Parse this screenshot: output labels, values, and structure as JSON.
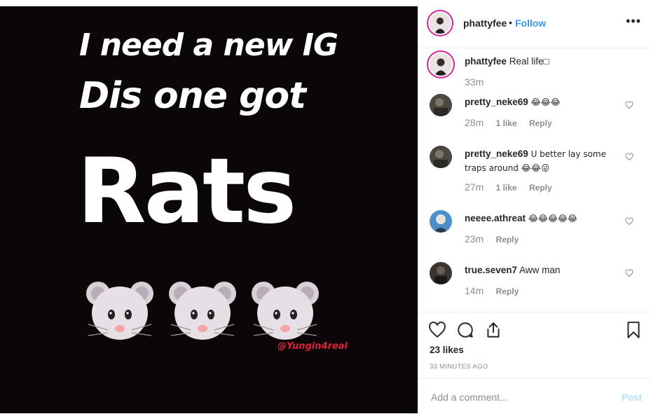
{
  "post": {
    "image_text": {
      "line1": "I need a new IG",
      "line2": "Dis one got",
      "line3": "Rats",
      "watermark": "@Yungin4real"
    }
  },
  "header": {
    "username": "phattyfee",
    "separator": "•",
    "follow": "Follow",
    "more": "•••"
  },
  "caption": {
    "username": "phattyfee",
    "text": "Real life□",
    "time": "33m"
  },
  "comments": [
    {
      "username": "pretty_neke69",
      "text": "😂😂😂",
      "time": "28m",
      "likes": "1 like",
      "reply": "Reply"
    },
    {
      "username": "pretty_neke69",
      "text": "U better lay some traps around 😂😂😜",
      "time": "27m",
      "likes": "1 like",
      "reply": "Reply"
    },
    {
      "username": "neeee.athreat",
      "text": "😂😂😂😂😂",
      "time": "23m",
      "likes": "",
      "reply": "Reply"
    },
    {
      "username": "true.seven7",
      "text": "Aww man",
      "time": "14m",
      "likes": "",
      "reply": "Reply"
    }
  ],
  "actions": {
    "likes": "23 likes",
    "time_ago": "33 MINUTES AGO"
  },
  "add_comment": {
    "placeholder": "Add a comment...",
    "post": "Post"
  },
  "colors": {
    "accent": "#3897f0",
    "watermark": "#e0203a",
    "image_bg": "#0b0708"
  }
}
